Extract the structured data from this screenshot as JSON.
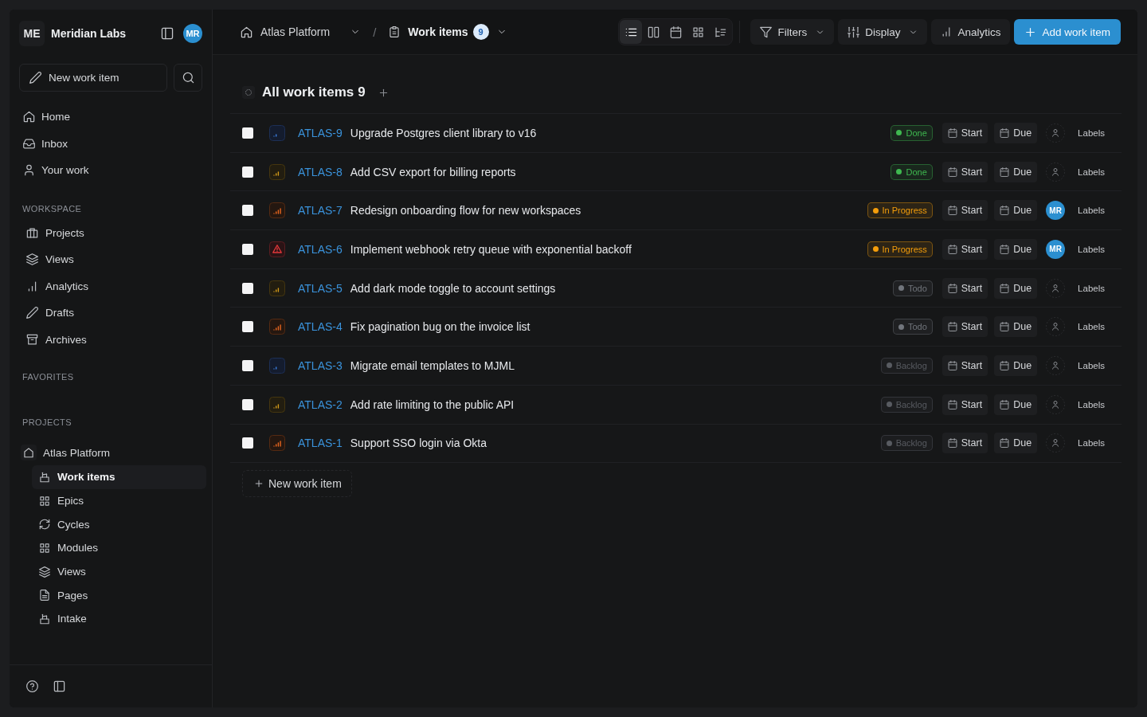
{
  "workspace": {
    "initials": "ME",
    "name": "Meridian Labs"
  },
  "user": {
    "initials": "MR"
  },
  "sidebar": {
    "new_item_button": "New work item",
    "nav": [
      {
        "label": "Home",
        "selected": false
      },
      {
        "label": "Inbox",
        "selected": false
      },
      {
        "label": "Your work",
        "selected": false
      }
    ],
    "workspace": {
      "title": "WORKSPACE",
      "items": [
        {
          "label": "Projects",
          "selected": false
        },
        {
          "label": "Views",
          "selected": false
        },
        {
          "label": "Analytics",
          "selected": false
        },
        {
          "label": "Drafts",
          "selected": false
        },
        {
          "label": "Archives",
          "selected": false
        }
      ]
    },
    "favorites": {
      "title": "FAVORITES"
    },
    "projects": {
      "title": "PROJECTS",
      "items": [
        {
          "name": "Atlas Platform",
          "children": [
            {
              "label": "Work items",
              "selected": true
            },
            {
              "label": "Epics",
              "selected": false
            },
            {
              "label": "Cycles",
              "selected": false
            },
            {
              "label": "Modules",
              "selected": false
            },
            {
              "label": "Views",
              "selected": false
            },
            {
              "label": "Pages",
              "selected": false
            },
            {
              "label": "Intake",
              "selected": false
            }
          ]
        }
      ]
    }
  },
  "breadcrumb": {
    "project": "Atlas Platform",
    "separator": "/",
    "page": "Work items",
    "count": "9"
  },
  "layouts": [
    {
      "kind": "list",
      "selected": true
    },
    {
      "kind": "board",
      "selected": false
    },
    {
      "kind": "calendar",
      "selected": false
    },
    {
      "kind": "spreadsheet",
      "selected": false
    },
    {
      "kind": "gantt",
      "selected": false
    }
  ],
  "toolbar": {
    "filters": "Filters",
    "display": "Display",
    "analytics": "Analytics",
    "add": "Add work item"
  },
  "list": {
    "title": "All work items",
    "count": "9",
    "rows": [
      {
        "checked": false,
        "priority": {
          "kind": "low"
        },
        "id": "ATLAS-9",
        "title": "Upgrade Postgres client library to v16",
        "status": {
          "label": "Done",
          "color": "#3fb950"
        },
        "start": "Start",
        "due": "Due",
        "labels": "Labels"
      },
      {
        "checked": false,
        "priority": {
          "kind": "medium"
        },
        "id": "ATLAS-8",
        "title": "Add CSV export for billing reports",
        "status": {
          "label": "Done",
          "color": "#3fb950"
        },
        "start": "Start",
        "due": "Due",
        "labels": "Labels"
      },
      {
        "checked": false,
        "priority": {
          "kind": "high"
        },
        "id": "ATLAS-7",
        "title": "Redesign onboarding flow for new workspaces",
        "status": {
          "label": "In Progress",
          "color": "#f59e0b"
        },
        "start": "Start",
        "due": "Due",
        "assignee": "MR",
        "labels": "Labels"
      },
      {
        "checked": false,
        "priority": {
          "kind": "urgent"
        },
        "id": "ATLAS-6",
        "title": "Implement webhook retry queue with exponential backoff",
        "status": {
          "label": "In Progress",
          "color": "#f59e0b"
        },
        "start": "Start",
        "due": "Due",
        "assignee": "MR",
        "labels": "Labels"
      },
      {
        "checked": false,
        "priority": {
          "kind": "medium"
        },
        "id": "ATLAS-5",
        "title": "Add dark mode toggle to account settings",
        "status": {
          "label": "Todo",
          "color": "#71757c"
        },
        "start": "Start",
        "due": "Due",
        "labels": "Labels"
      },
      {
        "checked": false,
        "priority": {
          "kind": "high"
        },
        "id": "ATLAS-4",
        "title": "Fix pagination bug on the invoice list",
        "status": {
          "label": "Todo",
          "color": "#71757c"
        },
        "start": "Start",
        "due": "Due",
        "labels": "Labels"
      },
      {
        "checked": false,
        "priority": {
          "kind": "low"
        },
        "id": "ATLAS-3",
        "title": "Migrate email templates to MJML",
        "status": {
          "label": "Backlog",
          "color": "#585b61"
        },
        "start": "Start",
        "due": "Due",
        "labels": "Labels"
      },
      {
        "checked": false,
        "priority": {
          "kind": "medium"
        },
        "id": "ATLAS-2",
        "title": "Add rate limiting to the public API",
        "status": {
          "label": "Backlog",
          "color": "#585b61"
        },
        "start": "Start",
        "due": "Due",
        "labels": "Labels"
      },
      {
        "checked": false,
        "priority": {
          "kind": "high"
        },
        "id": "ATLAS-1",
        "title": "Support SSO login via Okta",
        "status": {
          "label": "Backlog",
          "color": "#585b61"
        },
        "start": "Start",
        "due": "Due",
        "labels": "Labels"
      }
    ],
    "new_item_button": "New work item"
  }
}
